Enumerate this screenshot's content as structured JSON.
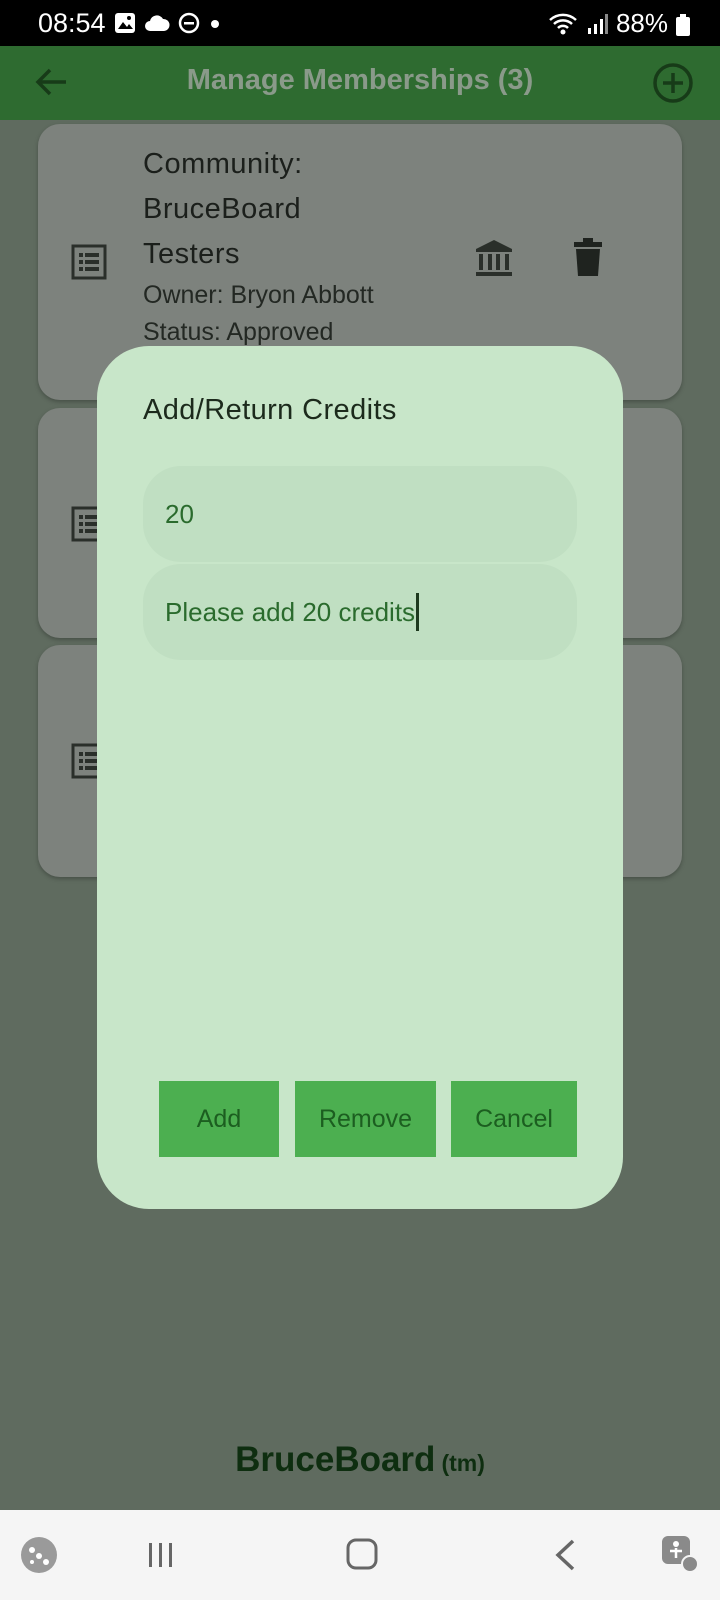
{
  "status_bar": {
    "time": "08:54",
    "battery": "88%",
    "icons": [
      "gallery-icon",
      "cloud-icon",
      "dnd-icon",
      "dot-icon",
      "wifi-icon",
      "signal-icon",
      "battery-icon"
    ]
  },
  "app_bar": {
    "title": "Manage Memberships (3)",
    "back_icon": "arrow-left-icon",
    "add_icon": "plus-circle-icon"
  },
  "cards": [
    {
      "name_lines": [
        "Community:",
        "BruceBoard",
        "Testers"
      ],
      "owner": "Owner: Bryon Abbott",
      "status": "Status: Approved"
    }
  ],
  "dialog": {
    "title": "Add/Return Credits",
    "amount_value": "20",
    "note_value": "Please add 20 credits",
    "buttons": {
      "add": "Add",
      "remove": "Remove",
      "cancel": "Cancel"
    }
  },
  "footer": {
    "brand": "BruceBoard",
    "tm": "(tm)"
  },
  "colors": {
    "app_bar": "#2e6b30",
    "dialog_bg": "#c8e6c9",
    "button_bg": "#4caf50",
    "scrim_bg": "#5f6b5f"
  }
}
